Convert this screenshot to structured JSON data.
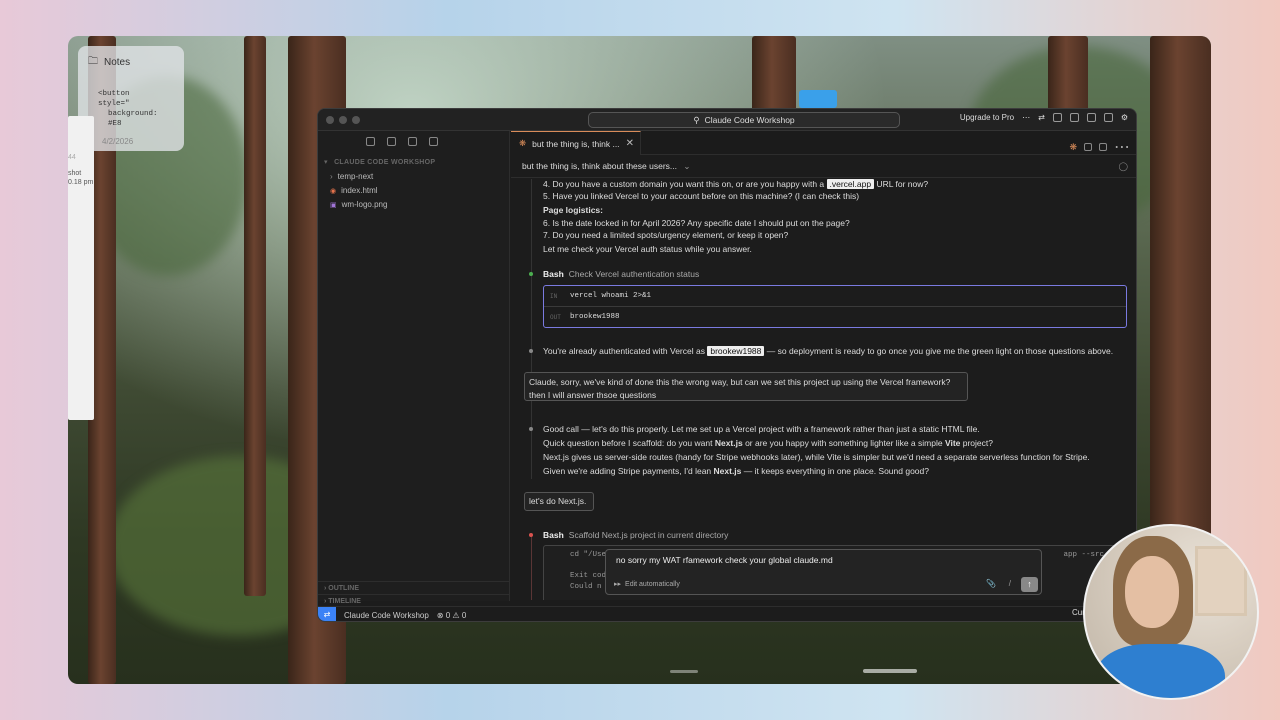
{
  "notes": {
    "title": "Notes",
    "snippet_line1": "<button",
    "snippet_line2": "style=\"",
    "snippet_line3": "background: #E8",
    "date": "4/2/2026"
  },
  "ghost_window": {
    "t1": "44",
    "t2": "shot",
    "t3": "0.18 pm"
  },
  "window": {
    "command_center": "Claude Code Workshop",
    "upgrade_label": "Upgrade to Pro"
  },
  "explorer": {
    "title": "CLAUDE CODE WORKSHOP",
    "items": [
      {
        "label": "temp-next",
        "kind": "folder"
      },
      {
        "label": "index.html",
        "kind": "html"
      },
      {
        "label": "wm-logo.png",
        "kind": "image"
      }
    ],
    "outline_label": "OUTLINE",
    "timeline_label": "TIMELINE"
  },
  "tab": {
    "label": "but the thing is, think ..."
  },
  "conversation": {
    "header": "but the thing is, think about these users...",
    "lines": {
      "q4_pre": "4. Do you have a custom domain you want this on, or are you happy with a ",
      "q4_pill": ".vercel.app",
      "q4_post": " URL for now?",
      "q5": "5. Have you linked Vercel to your account before on this machine? (I can check this)",
      "page_logistics": "Page logistics:",
      "q6": "6. Is the date locked in for April 2026? Any specific date I should put on the page?",
      "q7": "7. Do you need a limited spots/urgency element, or keep it open?",
      "check_auth": "Let me check your Vercel auth status while you answer."
    },
    "bash1": {
      "tool": "Bash",
      "description": "Check Vercel authentication status",
      "in_label": "IN",
      "in_cmd": "vercel whoami 2>&1",
      "out_label": "OUT",
      "out_value": "brookew1988"
    },
    "auth_pre": "You're already authenticated with Vercel as ",
    "auth_pill": "brookew1988",
    "auth_post": " — so deployment is ready to go once you give me the green light on those questions above.",
    "user1_line1": "Claude, sorry, we've kind of done this the wrong way, but can we set this project up using the Vercel framework?",
    "user1_line2": "then I will answer thsoe questions",
    "reply": {
      "l1": "Good call — let's do this properly. Let me set up a Vercel project with a framework rather than just a static HTML file.",
      "l2_pre": "Quick question before I scaffold: do you want ",
      "l2_b1": "Next.js",
      "l2_mid": " or are you happy with something lighter like a simple ",
      "l2_b2": "Vite",
      "l2_post": " project?",
      "l3": "Next.js gives us server-side routes (handy for Stripe webhooks later), while Vite is simpler but we'd need a separate serverless function for Stripe.",
      "l4_pre": "Given we're adding Stripe payments, I'd lean ",
      "l4_b": "Next.js",
      "l4_post": " — it keeps everything in one place. Sound good?"
    },
    "user2": "let's do Next.js.",
    "bash2": {
      "tool": "Bash",
      "description": "Scaffold Next.js project in current directory",
      "cmd_start": "cd \"/Use",
      "cmd_end": "app --src-dir",
      "out1": "Exit code",
      "out2": "Could n"
    }
  },
  "prompt": {
    "text": "no sorry my WAT rfamework check your global claude.md",
    "edit_mode": "Edit automatically",
    "slash": "/"
  },
  "statusbar": {
    "workspace": "Claude Code Workshop",
    "errors": "0",
    "warnings": "0",
    "right_text": "Curs"
  },
  "colors": {
    "accent": "#d98c5a",
    "remote": "#3b82f6",
    "bash_border": "#7a7ae0"
  }
}
